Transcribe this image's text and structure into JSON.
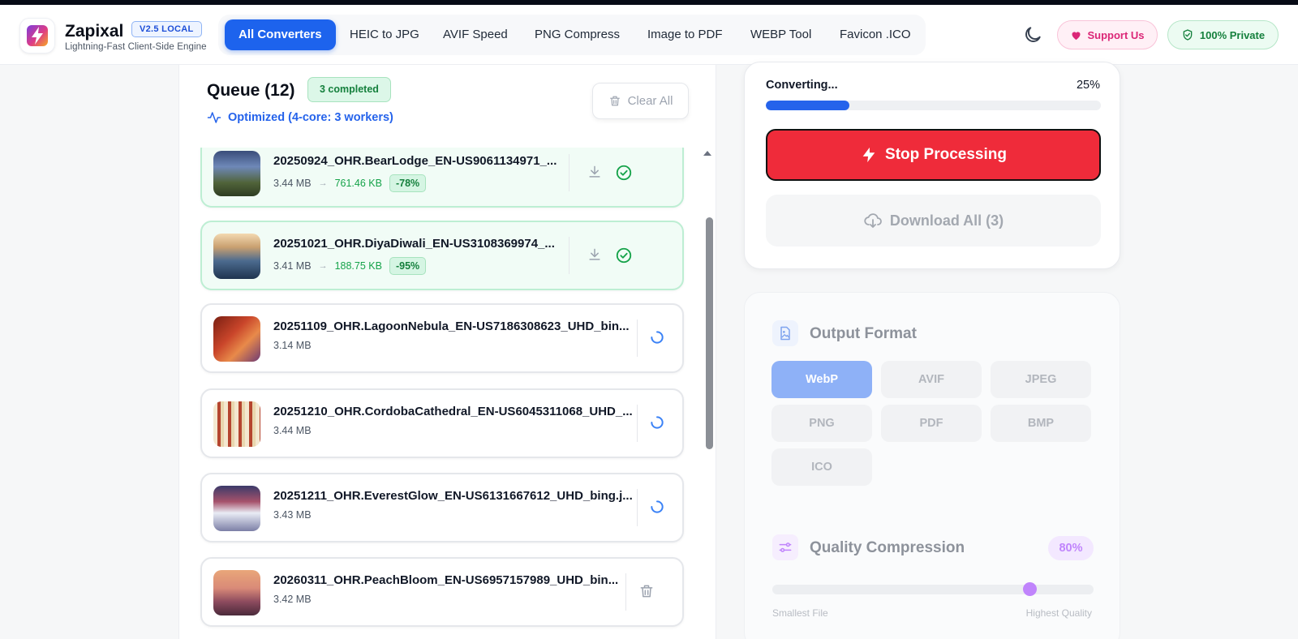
{
  "app": {
    "name": "Zapixal",
    "version": "V2.5 LOCAL",
    "tagline": "Lightning-Fast Client-Side Engine"
  },
  "nav": {
    "items": [
      {
        "label": "All Converters",
        "active": true
      },
      {
        "label": "HEIC to JPG",
        "active": false
      },
      {
        "label": "AVIF Speed",
        "active": false
      },
      {
        "label": "PNG Compress",
        "active": false
      },
      {
        "label": "Image to PDF",
        "active": false
      },
      {
        "label": "WEBP Tool",
        "active": false
      },
      {
        "label": "Favicon .ICO",
        "active": false
      }
    ]
  },
  "header_actions": {
    "theme_icon": "moon-icon",
    "support_label": "Support Us",
    "private_label": "100% Private"
  },
  "queue": {
    "title": "Queue (12)",
    "completed_badge": "3 completed",
    "optimized_label": "Optimized (4-core: 3 workers)",
    "clear_label": "Clear All",
    "items": [
      {
        "name": "20250924_OHR.BearLodge_EN-US9061134971_...",
        "size": "3.44 MB",
        "new_size": "761.46 KB",
        "reduction": "-78%",
        "status": "done"
      },
      {
        "name": "20251021_OHR.DiyaDiwali_EN-US3108369974_...",
        "size": "3.41 MB",
        "new_size": "188.75 KB",
        "reduction": "-95%",
        "status": "done"
      },
      {
        "name": "20251109_OHR.LagoonNebula_EN-US7186308623_UHD_bin...",
        "size": "3.14 MB",
        "status": "processing"
      },
      {
        "name": "20251210_OHR.CordobaCathedral_EN-US6045311068_UHD_...",
        "size": "3.44 MB",
        "status": "processing"
      },
      {
        "name": "20251211_OHR.EverestGlow_EN-US6131667612_UHD_bing.j...",
        "size": "3.43 MB",
        "status": "processing"
      },
      {
        "name": "20260311_OHR.PeachBloom_EN-US6957157989_UHD_bin...",
        "size": "3.42 MB",
        "status": "pending"
      }
    ]
  },
  "conversion": {
    "label": "Converting...",
    "percent_text": "25%",
    "progress": 0.25,
    "stop_label": "Stop Processing",
    "download_label": "Download All (3)"
  },
  "output_format": {
    "title": "Output Format",
    "options": [
      "WebP",
      "AVIF",
      "JPEG",
      "PNG",
      "PDF",
      "BMP",
      "ICO"
    ],
    "selected": "WebP"
  },
  "quality": {
    "title": "Quality Compression",
    "value_text": "80%",
    "value": 0.8,
    "min_label": "Smallest File",
    "max_label": "Highest Quality"
  },
  "colors": {
    "accent": "#1d63ed",
    "danger": "#ef2b3a",
    "success": "#16a34a",
    "purple": "#c084fc"
  }
}
